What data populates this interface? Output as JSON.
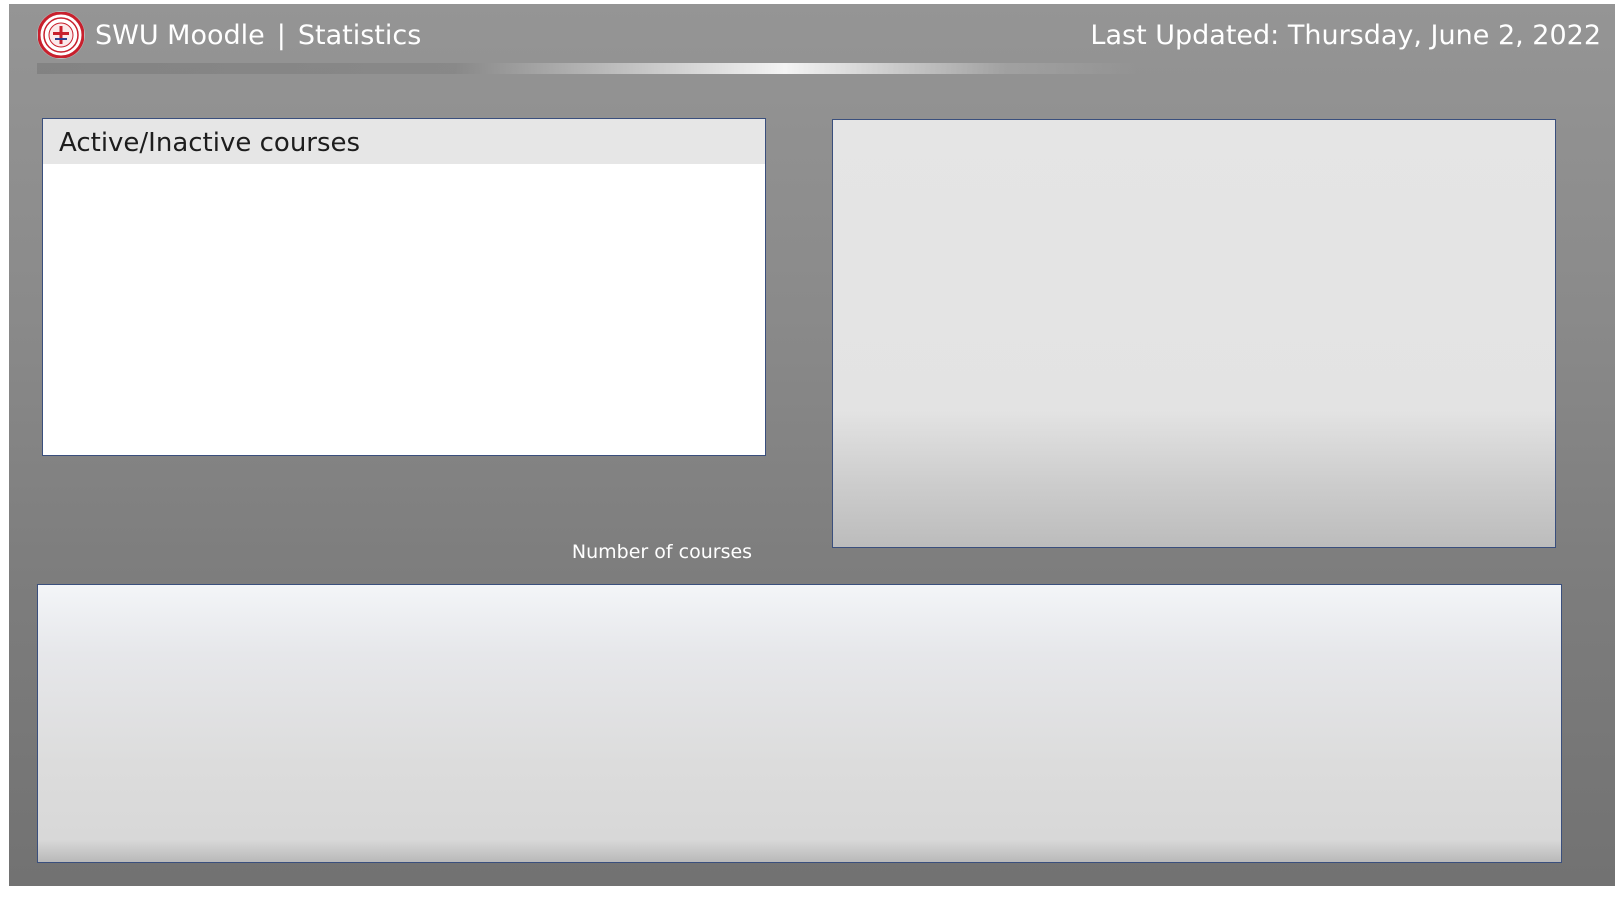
{
  "header": {
    "app_name": "SWU Moodle",
    "separator": "|",
    "page_name": "Statistics",
    "last_updated": "Last Updated: Thursday, June 2, 2022",
    "logo_icon": "university-seal-icon"
  },
  "panels": {
    "active_inactive": {
      "title": "Active/Inactive courses"
    },
    "number_of_courses": {
      "label": "Number of courses"
    }
  },
  "colors": {
    "background": "#8a8a8a",
    "panel_border": "#3a4f7d",
    "seal_red": "#c8202d",
    "title_text": "#ffffff"
  }
}
